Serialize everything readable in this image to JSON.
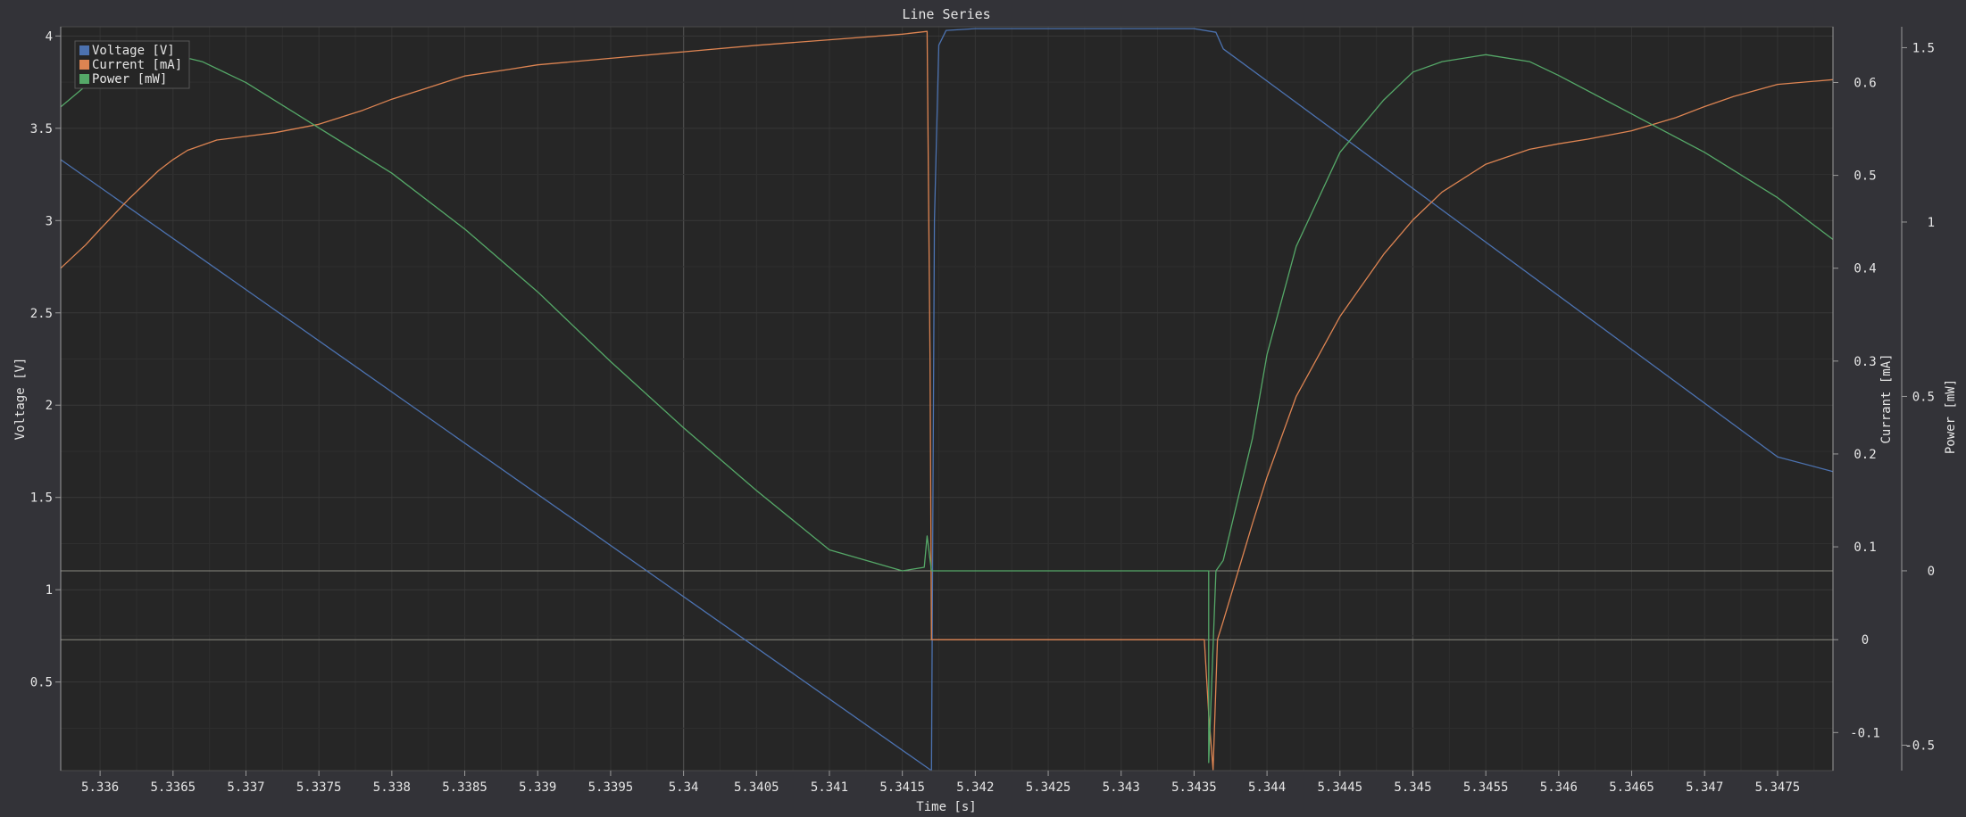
{
  "window": {
    "background": "#333338",
    "plot_background": "#262626"
  },
  "chart_data": {
    "type": "line",
    "title": "Line Series",
    "xlabel": "Time [s]",
    "xlim": [
      5.33573,
      5.34788
    ],
    "x_ticks": [
      5.336,
      5.3365,
      5.337,
      5.3375,
      5.338,
      5.3385,
      5.339,
      5.3395,
      5.34,
      5.3405,
      5.341,
      5.3415,
      5.342,
      5.3425,
      5.343,
      5.3435,
      5.344,
      5.3445,
      5.345,
      5.3455,
      5.346,
      5.3465,
      5.347,
      5.3475
    ],
    "x_tick_labels": [
      "5.336",
      "5.3365",
      "5.337",
      "5.3375",
      "5.338",
      "5.3385",
      "5.339",
      "5.3395",
      "5.34",
      "5.3405",
      "5.341",
      "5.3415",
      "5.342",
      "5.3425",
      "5.343",
      "5.3435",
      "5.344",
      "5.3445",
      "5.345",
      "5.3455",
      "5.346",
      "5.3465",
      "5.347",
      "5.3475"
    ],
    "grid": true,
    "legend_position": "top-left",
    "axes": [
      {
        "id": "voltage",
        "side": "left",
        "label": "Voltage [V]",
        "ylim": [
          0.02,
          4.05
        ],
        "ticks": [
          0.5,
          1,
          1.5,
          2,
          2.5,
          3,
          3.5,
          4
        ],
        "tick_labels": [
          "0.5",
          "1",
          "1.5",
          "2",
          "2.5",
          "3",
          "3.5",
          "4"
        ]
      },
      {
        "id": "current",
        "side": "right",
        "label": "Currant [mA]",
        "ylim": [
          -0.141,
          0.66
        ],
        "ticks": [
          -0.1,
          0,
          0.1,
          0.2,
          0.3,
          0.4,
          0.5,
          0.6
        ],
        "tick_labels": [
          "-0.1",
          "0",
          "0.1",
          "0.2",
          "0.3",
          "0.4",
          "0.5",
          "0.6"
        ]
      },
      {
        "id": "power",
        "side": "right-outer",
        "label": "Power [mW]",
        "ylim": [
          -0.573,
          1.56
        ],
        "ticks": [
          -0.5,
          0,
          0.5,
          1,
          1.5
        ],
        "tick_labels": [
          "-0.5",
          "0",
          "0.5",
          "1",
          "1.5"
        ]
      }
    ],
    "series": [
      {
        "name": "Voltage [V]",
        "axis": "voltage",
        "color": "#4c72b0",
        "points": [
          [
            5.33573,
            3.33
          ],
          [
            5.3417,
            0.02
          ],
          [
            5.34172,
            3.0
          ],
          [
            5.34175,
            3.95
          ],
          [
            5.3418,
            4.03
          ],
          [
            5.342,
            4.04
          ],
          [
            5.343,
            4.04
          ],
          [
            5.3435,
            4.04
          ],
          [
            5.34365,
            4.02
          ],
          [
            5.3437,
            3.93
          ],
          [
            5.3475,
            1.72
          ],
          [
            5.34788,
            1.64
          ]
        ]
      },
      {
        "name": "Current [mA]",
        "axis": "current",
        "color": "#dd8452",
        "points": [
          [
            5.33573,
            0.4
          ],
          [
            5.3359,
            0.425
          ],
          [
            5.336,
            0.442
          ],
          [
            5.3362,
            0.475
          ],
          [
            5.3364,
            0.505
          ],
          [
            5.3365,
            0.517
          ],
          [
            5.3366,
            0.527
          ],
          [
            5.3368,
            0.538
          ],
          [
            5.337,
            0.542
          ],
          [
            5.3372,
            0.546
          ],
          [
            5.3375,
            0.555
          ],
          [
            5.3378,
            0.57
          ],
          [
            5.338,
            0.582
          ],
          [
            5.3383,
            0.597
          ],
          [
            5.3385,
            0.607
          ],
          [
            5.3388,
            0.614
          ],
          [
            5.339,
            0.619
          ],
          [
            5.3395,
            0.626
          ],
          [
            5.34,
            0.633
          ],
          [
            5.3405,
            0.64
          ],
          [
            5.341,
            0.646
          ],
          [
            5.3415,
            0.652
          ],
          [
            5.34167,
            0.655
          ],
          [
            5.34169,
            0.3
          ],
          [
            5.3417,
            0.0
          ],
          [
            5.3435,
            0.0
          ],
          [
            5.34357,
            0.0
          ],
          [
            5.3436,
            -0.08
          ],
          [
            5.34363,
            -0.14
          ],
          [
            5.34366,
            0.0
          ],
          [
            5.3437,
            0.02
          ],
          [
            5.3439,
            0.125
          ],
          [
            5.344,
            0.175
          ],
          [
            5.3442,
            0.262
          ],
          [
            5.3445,
            0.348
          ],
          [
            5.3448,
            0.415
          ],
          [
            5.345,
            0.452
          ],
          [
            5.3452,
            0.482
          ],
          [
            5.3455,
            0.512
          ],
          [
            5.3458,
            0.528
          ],
          [
            5.346,
            0.534
          ],
          [
            5.3462,
            0.539
          ],
          [
            5.3465,
            0.548
          ],
          [
            5.3468,
            0.562
          ],
          [
            5.347,
            0.574
          ],
          [
            5.3472,
            0.585
          ],
          [
            5.3475,
            0.598
          ],
          [
            5.34788,
            0.603
          ]
        ]
      },
      {
        "name": "Power [mW]",
        "axis": "power",
        "color": "#55a868",
        "points": [
          [
            5.33573,
            1.33
          ],
          [
            5.3359,
            1.39
          ],
          [
            5.336,
            1.41
          ],
          [
            5.3362,
            1.45
          ],
          [
            5.3363,
            1.47
          ],
          [
            5.3364,
            1.48
          ],
          [
            5.3365,
            1.48
          ],
          [
            5.3367,
            1.46
          ],
          [
            5.337,
            1.4
          ],
          [
            5.3375,
            1.27
          ],
          [
            5.338,
            1.14
          ],
          [
            5.3385,
            0.98
          ],
          [
            5.339,
            0.8
          ],
          [
            5.3395,
            0.6
          ],
          [
            5.34,
            0.41
          ],
          [
            5.3405,
            0.23
          ],
          [
            5.341,
            0.06
          ],
          [
            5.3415,
            -0.0
          ],
          [
            5.34165,
            0.01
          ],
          [
            5.34167,
            0.1
          ],
          [
            5.3417,
            0.0
          ],
          [
            5.3436,
            0.0
          ],
          [
            5.3436,
            -0.55
          ],
          [
            5.34365,
            0.0
          ],
          [
            5.3437,
            0.03
          ],
          [
            5.3439,
            0.38
          ],
          [
            5.344,
            0.62
          ],
          [
            5.3442,
            0.93
          ],
          [
            5.3445,
            1.2
          ],
          [
            5.3448,
            1.35
          ],
          [
            5.345,
            1.43
          ],
          [
            5.3452,
            1.46
          ],
          [
            5.3455,
            1.48
          ],
          [
            5.3458,
            1.46
          ],
          [
            5.346,
            1.42
          ],
          [
            5.3465,
            1.31
          ],
          [
            5.347,
            1.2
          ],
          [
            5.3475,
            1.07
          ],
          [
            5.34788,
            0.95
          ]
        ]
      }
    ]
  }
}
